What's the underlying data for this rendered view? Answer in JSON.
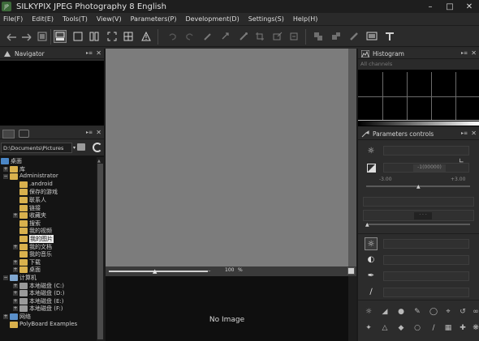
{
  "window": {
    "title": "SILKYPIX JPEG Photography 8 English",
    "app_icon_text": "JP"
  },
  "menu": [
    "File(F)",
    "Edit(E)",
    "Tools(T)",
    "View(V)",
    "Parameters(P)",
    "Development(D)",
    "Settings(S)",
    "Help(H)"
  ],
  "navigator": {
    "title": "Navigator"
  },
  "folders": {
    "path": "D:\\Documents\\Pictures",
    "items": [
      {
        "label": "桌面",
        "indent": 0,
        "expander": "−",
        "icon": "desktop"
      },
      {
        "label": "库",
        "indent": 1,
        "expander": "+",
        "icon": "folder"
      },
      {
        "label": "Administrator",
        "indent": 1,
        "expander": "−",
        "icon": "folder"
      },
      {
        "label": ".android",
        "indent": 2,
        "expander": "",
        "icon": "folder"
      },
      {
        "label": "保存的游戏",
        "indent": 2,
        "expander": "",
        "icon": "folder"
      },
      {
        "label": "联系人",
        "indent": 2,
        "expander": "",
        "icon": "folder"
      },
      {
        "label": "链接",
        "indent": 2,
        "expander": "",
        "icon": "folder"
      },
      {
        "label": "收藏夹",
        "indent": 2,
        "expander": "+",
        "icon": "folder"
      },
      {
        "label": "搜索",
        "indent": 2,
        "expander": "",
        "icon": "folder"
      },
      {
        "label": "我的视频",
        "indent": 2,
        "expander": "",
        "icon": "folder"
      },
      {
        "label": "我的图片",
        "indent": 2,
        "expander": "",
        "icon": "folder",
        "selected": true
      },
      {
        "label": "我的文档",
        "indent": 2,
        "expander": "+",
        "icon": "folder"
      },
      {
        "label": "我的音乐",
        "indent": 2,
        "expander": "",
        "icon": "folder"
      },
      {
        "label": "下载",
        "indent": 2,
        "expander": "+",
        "icon": "folder"
      },
      {
        "label": "桌面",
        "indent": 2,
        "expander": "+",
        "icon": "folder"
      },
      {
        "label": "计算机",
        "indent": 1,
        "expander": "−",
        "icon": "computer"
      },
      {
        "label": "本地磁盘 (C:)",
        "indent": 2,
        "expander": "+",
        "icon": "drive"
      },
      {
        "label": "本地磁盘 (D:)",
        "indent": 2,
        "expander": "+",
        "icon": "drive"
      },
      {
        "label": "本地磁盘 (E:)",
        "indent": 2,
        "expander": "+",
        "icon": "drive"
      },
      {
        "label": "本地磁盘 (F:)",
        "indent": 2,
        "expander": "+",
        "icon": "drive"
      },
      {
        "label": "网络",
        "indent": 1,
        "expander": "+",
        "icon": "network"
      },
      {
        "label": "PolyBoard Examples",
        "indent": 1,
        "expander": "",
        "icon": "folder"
      }
    ]
  },
  "viewer": {
    "zoom_value": "100",
    "zoom_unit": "%",
    "preview_text": "No Image"
  },
  "histogram": {
    "title": "Histogram",
    "channel": "All channels"
  },
  "parameters": {
    "title": "Parameters controls",
    "exposure_value": "-1(00000)",
    "exposure_min": "-3.00",
    "exposure_max": "+3.00",
    "field_dots": "· · ·"
  },
  "colors": {
    "viewer_gray": "#7c7c7c",
    "panel_bg": "#2a2a2a",
    "folder_yellow": "#d9b14d",
    "selection_bg": "#3a5f8f"
  }
}
